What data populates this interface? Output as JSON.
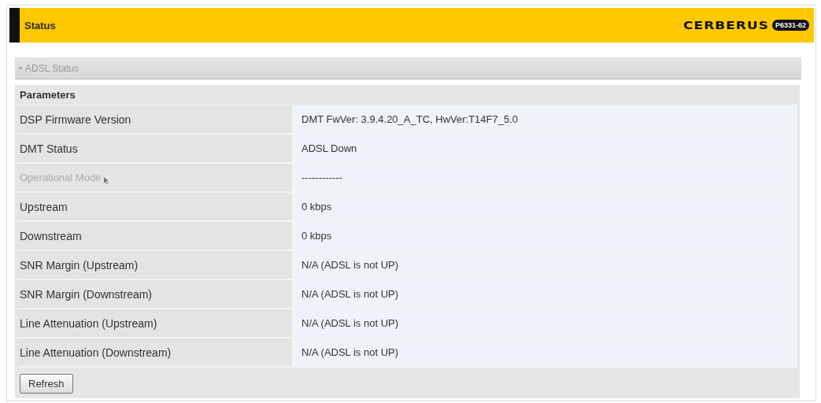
{
  "header": {
    "title": "Status",
    "logo": "CERBERUS",
    "model_badge": "P6331-62"
  },
  "section": {
    "title": "ADSL Status",
    "expanded": true
  },
  "table": {
    "heading": "Parameters",
    "rows": [
      {
        "label": "DSP Firmware Version",
        "value": "DMT FwVer: 3.9.4.20_A_TC, HwVer:T14F7_5.0",
        "dimmed": false
      },
      {
        "label": "DMT Status",
        "value": "ADSL Down",
        "dimmed": false
      },
      {
        "label": "Operational Mode",
        "value": "------------",
        "dimmed": true
      },
      {
        "label": "Upstream",
        "value": "0 kbps",
        "dimmed": false
      },
      {
        "label": "Downstream",
        "value": "0 kbps",
        "dimmed": false
      },
      {
        "label": "SNR Margin (Upstream)",
        "value": "N/A (ADSL is not UP)",
        "dimmed": false
      },
      {
        "label": "SNR Margin (Downstream)",
        "value": "N/A (ADSL is not UP)",
        "dimmed": false
      },
      {
        "label": "Line Attenuation (Upstream)",
        "value": "N/A (ADSL is not UP)",
        "dimmed": false
      },
      {
        "label": "Line Attenuation (Downstream)",
        "value": "N/A (ADSL is not UP)",
        "dimmed": false
      }
    ]
  },
  "buttons": [
    "Refresh"
  ]
}
